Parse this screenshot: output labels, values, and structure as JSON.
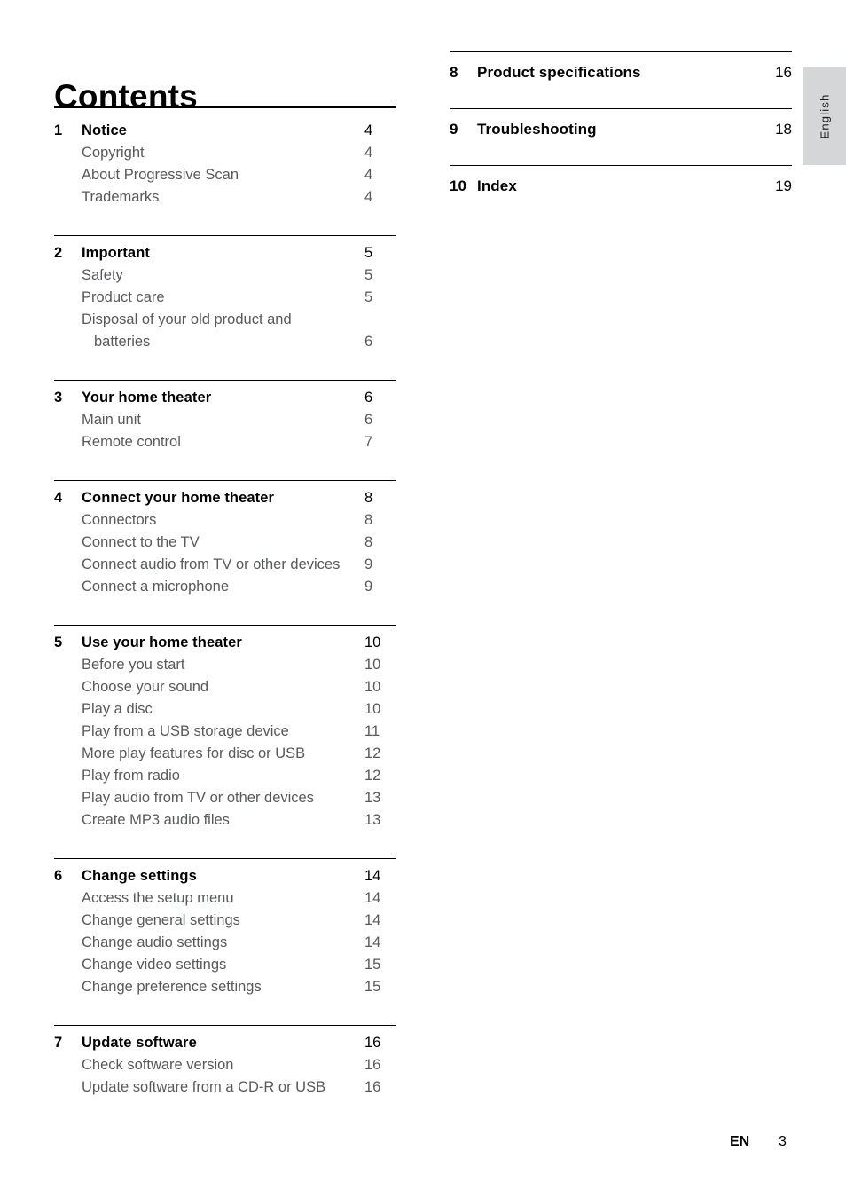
{
  "document": {
    "title": "Contents",
    "language_tab": "English",
    "footer": {
      "locale_code": "EN",
      "page_number": "3"
    }
  },
  "toc": {
    "left_column": [
      {
        "number": "1",
        "title": "Notice",
        "page": "4",
        "entries": [
          {
            "label": "Copyright",
            "page": "4",
            "continuation": false
          },
          {
            "label": "About Progressive Scan",
            "page": "4",
            "continuation": false
          },
          {
            "label": "Trademarks",
            "page": "4",
            "continuation": false
          }
        ]
      },
      {
        "number": "2",
        "title": "Important",
        "page": "5",
        "entries": [
          {
            "label": "Safety",
            "page": "5",
            "continuation": false
          },
          {
            "label": "Product care",
            "page": "5",
            "continuation": false
          },
          {
            "label": "Disposal of your old product and",
            "page": "",
            "continuation": false
          },
          {
            "label": "batteries",
            "page": "6",
            "continuation": true
          }
        ]
      },
      {
        "number": "3",
        "title": "Your home theater",
        "page": "6",
        "entries": [
          {
            "label": "Main unit",
            "page": "6",
            "continuation": false
          },
          {
            "label": "Remote control",
            "page": "7",
            "continuation": false
          }
        ]
      },
      {
        "number": "4",
        "title": "Connect your home theater",
        "page": "8",
        "entries": [
          {
            "label": "Connectors",
            "page": "8",
            "continuation": false
          },
          {
            "label": "Connect to the TV",
            "page": "8",
            "continuation": false
          },
          {
            "label": "Connect audio from TV or other devices",
            "page": "9",
            "continuation": false
          },
          {
            "label": "Connect a microphone",
            "page": "9",
            "continuation": false
          }
        ]
      },
      {
        "number": "5",
        "title": "Use your home theater",
        "page": "10",
        "entries": [
          {
            "label": "Before you start",
            "page": "10",
            "continuation": false
          },
          {
            "label": "Choose your sound",
            "page": "10",
            "continuation": false
          },
          {
            "label": "Play a disc",
            "page": "10",
            "continuation": false
          },
          {
            "label": "Play from a USB storage device",
            "page": "11",
            "continuation": false
          },
          {
            "label": "More play features for disc or USB",
            "page": "12",
            "continuation": false
          },
          {
            "label": "Play from radio",
            "page": "12",
            "continuation": false
          },
          {
            "label": "Play audio from TV or other devices",
            "page": "13",
            "continuation": false
          },
          {
            "label": "Create MP3 audio files",
            "page": "13",
            "continuation": false
          }
        ]
      },
      {
        "number": "6",
        "title": "Change settings",
        "page": "14",
        "entries": [
          {
            "label": "Access the setup menu",
            "page": "14",
            "continuation": false
          },
          {
            "label": "Change general settings",
            "page": "14",
            "continuation": false
          },
          {
            "label": "Change audio settings",
            "page": "14",
            "continuation": false
          },
          {
            "label": "Change video settings",
            "page": "15",
            "continuation": false
          },
          {
            "label": "Change preference settings",
            "page": "15",
            "continuation": false
          }
        ]
      },
      {
        "number": "7",
        "title": "Update software",
        "page": "16",
        "entries": [
          {
            "label": "Check software version",
            "page": "16",
            "continuation": false
          },
          {
            "label": "Update software from a CD-R or USB",
            "page": "16",
            "continuation": false
          }
        ]
      }
    ],
    "right_column": [
      {
        "number": "8",
        "title": "Product specifications",
        "page": "16",
        "entries": []
      },
      {
        "number": "9",
        "title": "Troubleshooting",
        "page": "18",
        "entries": []
      },
      {
        "number": "10",
        "title": "Index",
        "page": "19",
        "entries": []
      }
    ]
  },
  "colors": {
    "text": "#000000",
    "subentry_text": "#58595b",
    "rule": "#000000",
    "language_tab_bg": "#d5d6d8"
  }
}
